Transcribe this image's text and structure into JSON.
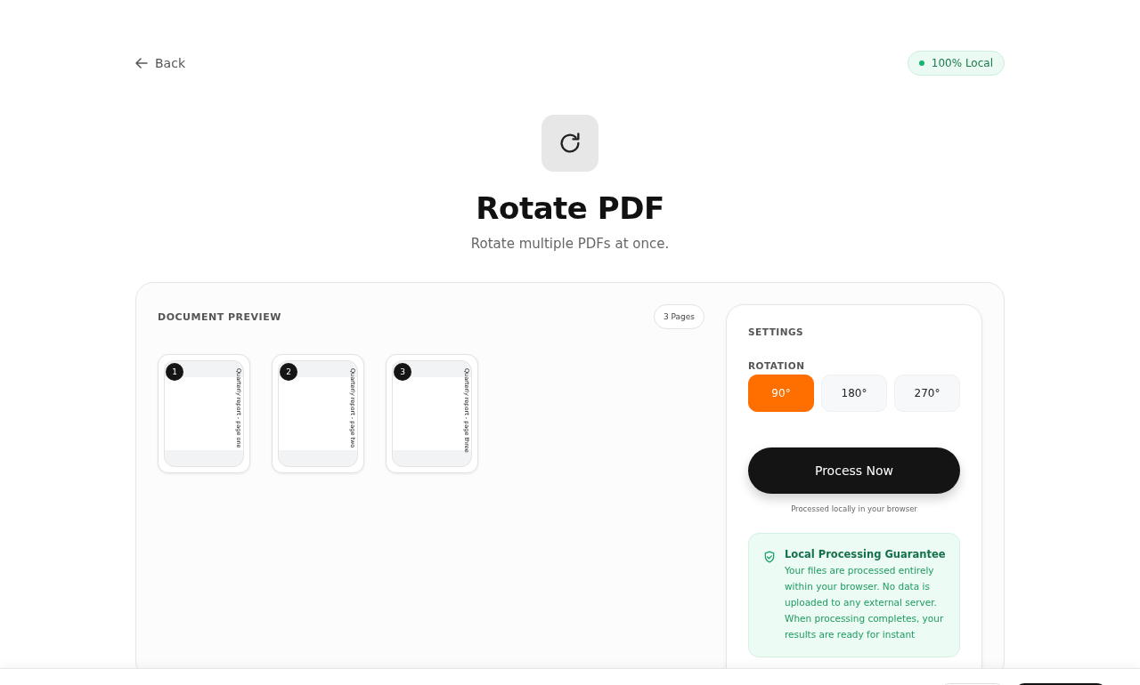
{
  "nav": {
    "back": "Back",
    "badge": "100% Local"
  },
  "header": {
    "title": "Rotate PDF",
    "subtitle": "Rotate multiple PDFs at once."
  },
  "preview": {
    "heading": "DOCUMENT PREVIEW",
    "page_count": "3 Pages",
    "pages": [
      {
        "number": "1",
        "caption": "Quarterly report - page one"
      },
      {
        "number": "2",
        "caption": "Quarterly report - page two"
      },
      {
        "number": "3",
        "caption": "Quarterly report - page three"
      }
    ]
  },
  "settings": {
    "heading": "SETTINGS",
    "rotation_label": "ROTATION",
    "options": [
      {
        "label": "90°",
        "selected": true
      },
      {
        "label": "180°",
        "selected": false
      },
      {
        "label": "270°",
        "selected": false
      }
    ],
    "process_button": "Process Now",
    "note": "Processed locally in your browser",
    "guarantee": {
      "title": "Local Processing Guarantee",
      "text": "Your files are processed entirely within your browser. No data is uploaded to any external server. When processing completes, your results are ready for instant"
    }
  }
}
